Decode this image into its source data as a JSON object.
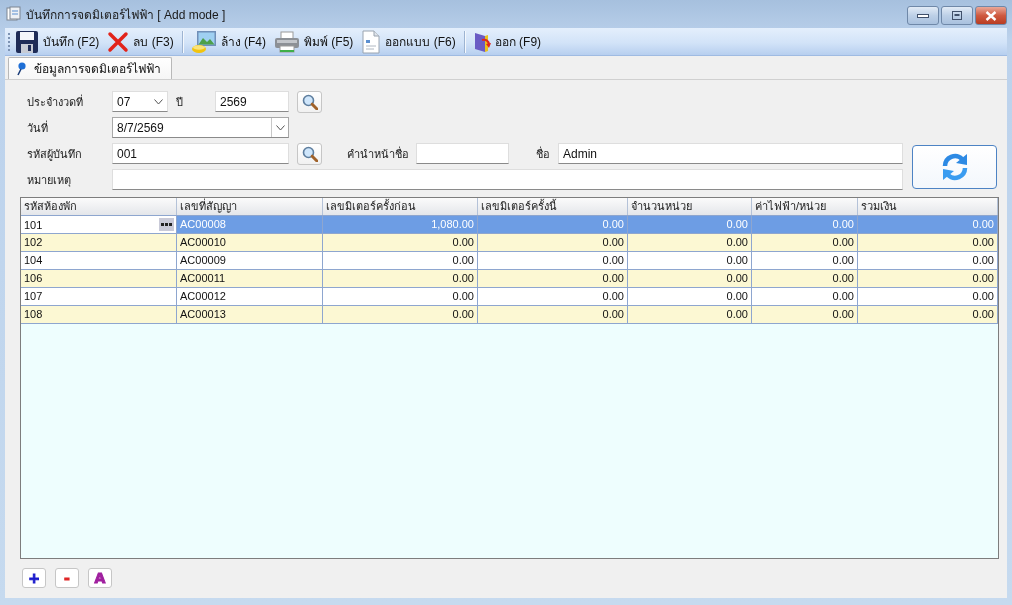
{
  "window": {
    "title": "บันทึกการจดมิเตอร์ไฟฟ้า [ Add mode ]"
  },
  "toolbar": {
    "groups": [
      {
        "buttons": [
          {
            "kind": "save",
            "label": "บันทึก (F2)"
          },
          {
            "kind": "delete",
            "label": "ลบ (F3)"
          }
        ]
      },
      {
        "buttons": [
          {
            "kind": "clear",
            "label": "ล้าง (F4)"
          },
          {
            "kind": "print",
            "label": "พิมพ์ (F5)"
          },
          {
            "kind": "design",
            "label": "ออกแบบ (F6)"
          }
        ]
      },
      {
        "buttons": [
          {
            "kind": "exit",
            "label": "ออก (F9)"
          }
        ]
      }
    ]
  },
  "tabs": [
    {
      "label": "ข้อมูลการจดมิเตอร์ไฟฟ้า",
      "selected": true
    }
  ],
  "form": {
    "period": {
      "label": "ประจำงวดที่",
      "value": "07"
    },
    "year": {
      "label": "ปี",
      "value": "2569"
    },
    "date": {
      "label": "วันที่",
      "value": "8/7/2569"
    },
    "recorder_code": {
      "label": "รหัสผู้บันทึก",
      "value": "001"
    },
    "name_prefix": {
      "label": "คำนำหน้าชื่อ"
    },
    "name": {
      "label": "ชื่อ",
      "value": "Admin"
    },
    "note": {
      "label": "หมายเหตุ"
    }
  },
  "table": {
    "columns": [
      {
        "label": "รหัสห้องพัก",
        "kind": "text"
      },
      {
        "label": "เลขที่สัญญา",
        "kind": "text"
      },
      {
        "label": "เลขมิเตอร์ครั้งก่อน",
        "kind": "number"
      },
      {
        "label": "เลขมิเตอร์ครั้งนี้",
        "kind": "number"
      },
      {
        "label": "จำนวนหน่วย",
        "kind": "number"
      },
      {
        "label": "ค่าไฟฟ้า/หน่วย",
        "kind": "number"
      },
      {
        "label": "รวมเงิน",
        "kind": "number"
      }
    ],
    "rows": [
      {
        "cells": [
          "101",
          "AC00008",
          "1,080.00",
          "0.00",
          "0.00",
          "0.00",
          "0.00"
        ],
        "selected": true,
        "editing": true
      },
      {
        "cells": [
          "102",
          "AC00010",
          "0.00",
          "0.00",
          "0.00",
          "0.00",
          "0.00"
        ],
        "selected": false,
        "editing": false
      },
      {
        "cells": [
          "104",
          "AC00009",
          "0.00",
          "0.00",
          "0.00",
          "0.00",
          "0.00"
        ],
        "selected": false,
        "editing": false
      },
      {
        "cells": [
          "106",
          "AC00011",
          "0.00",
          "0.00",
          "0.00",
          "0.00",
          "0.00"
        ],
        "selected": false,
        "editing": false
      },
      {
        "cells": [
          "107",
          "AC00012",
          "0.00",
          "0.00",
          "0.00",
          "0.00",
          "0.00"
        ],
        "selected": false,
        "editing": false
      },
      {
        "cells": [
          "108",
          "AC00013",
          "0.00",
          "0.00",
          "0.00",
          "0.00",
          "0.00"
        ],
        "selected": false,
        "editing": false
      }
    ]
  },
  "bottom_buttons": [
    {
      "label": "+",
      "color": "#1a1acc"
    },
    {
      "label": "-",
      "color": "#e02828"
    },
    {
      "label": "A",
      "color": "#a0209f"
    }
  ]
}
